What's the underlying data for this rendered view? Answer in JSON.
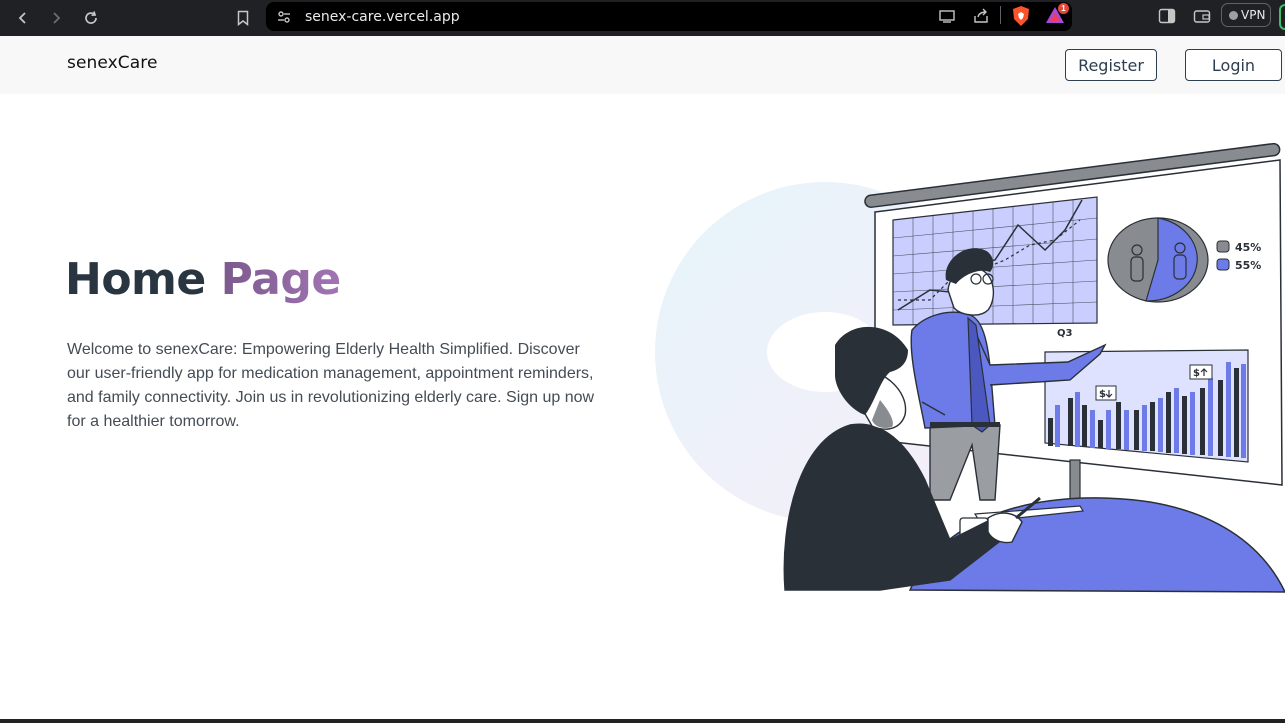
{
  "browser": {
    "url": "senex-care.vercel.app",
    "notification_count": "1",
    "vpn_label": "VPN"
  },
  "header": {
    "logo": "senexCare",
    "register_label": "Register",
    "login_label": "Login"
  },
  "hero": {
    "title_part1": "Home",
    "title_part2": "Page",
    "description": "Welcome to senexCare: Empowering Elderly Health Simplified. Discover our user-friendly app for medication management, appointment reminders, and family connectivity. Join us in revolutionizing elderly care. Sign up now for a healthier tomorrow."
  },
  "illustration": {
    "chart_label": "Q3",
    "legend_1": "45%",
    "legend_2": "55%",
    "money_down": "$",
    "money_up": "$"
  },
  "colors": {
    "accent": "#6c7be8",
    "header_bg": "#f8f8f8",
    "title_dark": "#2a3542",
    "title_purple": "#8e69a0"
  }
}
